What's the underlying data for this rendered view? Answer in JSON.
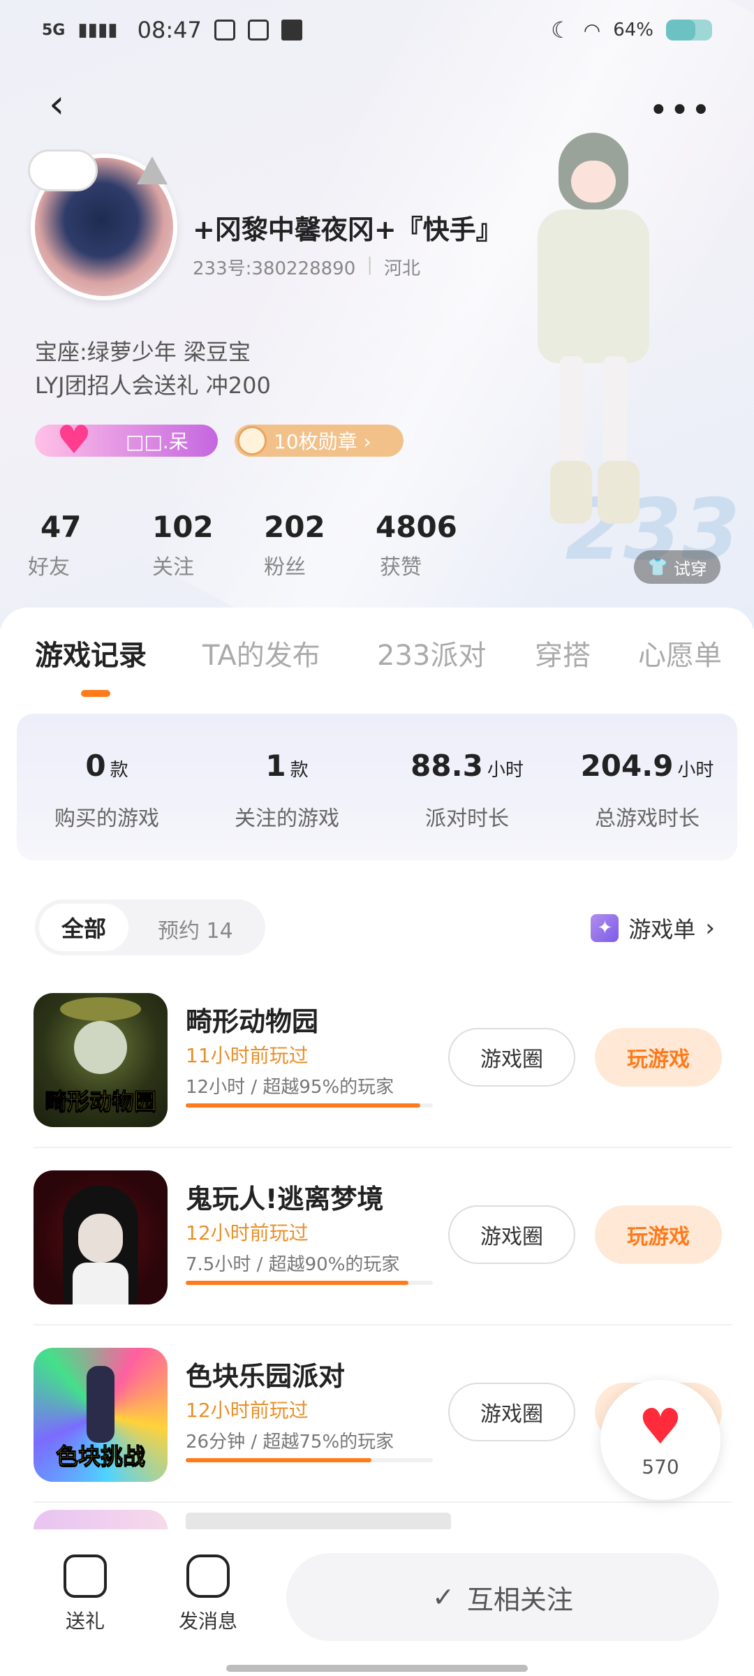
{
  "status_bar": {
    "network": "5G",
    "time": "08:47",
    "battery": "64%"
  },
  "profile": {
    "username": "+冈黎中馨夜冈+『快手』",
    "id": "233号:380228890",
    "region": "河北",
    "bio_line1": "宝座:绿萝少年 梁豆宝",
    "bio_line2": "LYJ团招人会送礼 冲200",
    "badge_pink_label": "□□.呆",
    "badge_medal_label": "10枚勋章 ›",
    "try_on_label": "试穿",
    "deco_text": "233"
  },
  "stats": [
    {
      "value": "47",
      "label": "好友"
    },
    {
      "value": "102",
      "label": "关注"
    },
    {
      "value": "202",
      "label": "粉丝"
    },
    {
      "value": "4806",
      "label": "获赞"
    }
  ],
  "tabs": [
    {
      "label": "游戏记录",
      "active": true
    },
    {
      "label": "TA的发布",
      "active": false
    },
    {
      "label": "233派对",
      "active": false
    },
    {
      "label": "穿搭",
      "active": false
    },
    {
      "label": "心愿单",
      "active": false
    }
  ],
  "summary": [
    {
      "value": "0",
      "unit": "款",
      "label": "购买的游戏"
    },
    {
      "value": "1",
      "unit": "款",
      "label": "关注的游戏"
    },
    {
      "value": "88.3",
      "unit": "小时",
      "label": "派对时长"
    },
    {
      "value": "204.9",
      "unit": "小时",
      "label": "总游戏时长"
    }
  ],
  "filter": {
    "all": "全部",
    "reserved": "预约 14"
  },
  "game_list_link": "游戏单",
  "games": [
    {
      "title": "畸形动物园",
      "cover_text": "畸形动物园",
      "last_played": "11小时前玩过",
      "stat": "12小时 / 超越95%的玩家",
      "progress": 0.95,
      "circle_label": "游戏圈",
      "play_label": "玩游戏"
    },
    {
      "title": "鬼玩人!逃离梦境",
      "cover_text": "",
      "last_played": "12小时前玩过",
      "stat": "7.5小时 / 超越90%的玩家",
      "progress": 0.9,
      "circle_label": "游戏圈",
      "play_label": "玩游戏"
    },
    {
      "title": "色块乐园派对",
      "cover_text": "色块挑战",
      "last_played": "12小时前玩过",
      "stat": "26分钟 / 超越75%的玩家",
      "progress": 0.75,
      "circle_label": "游戏圈",
      "play_label": "玩游戏"
    }
  ],
  "like": {
    "count": "570"
  },
  "bottom_bar": {
    "gift_label": "送礼",
    "message_label": "发消息",
    "follow_label": "互相关注"
  },
  "colors": {
    "accent": "#ff7a1a",
    "play_bg": "#ffe9d6",
    "last_played": "#e8902a",
    "like_heart": "#ff2a3a"
  }
}
